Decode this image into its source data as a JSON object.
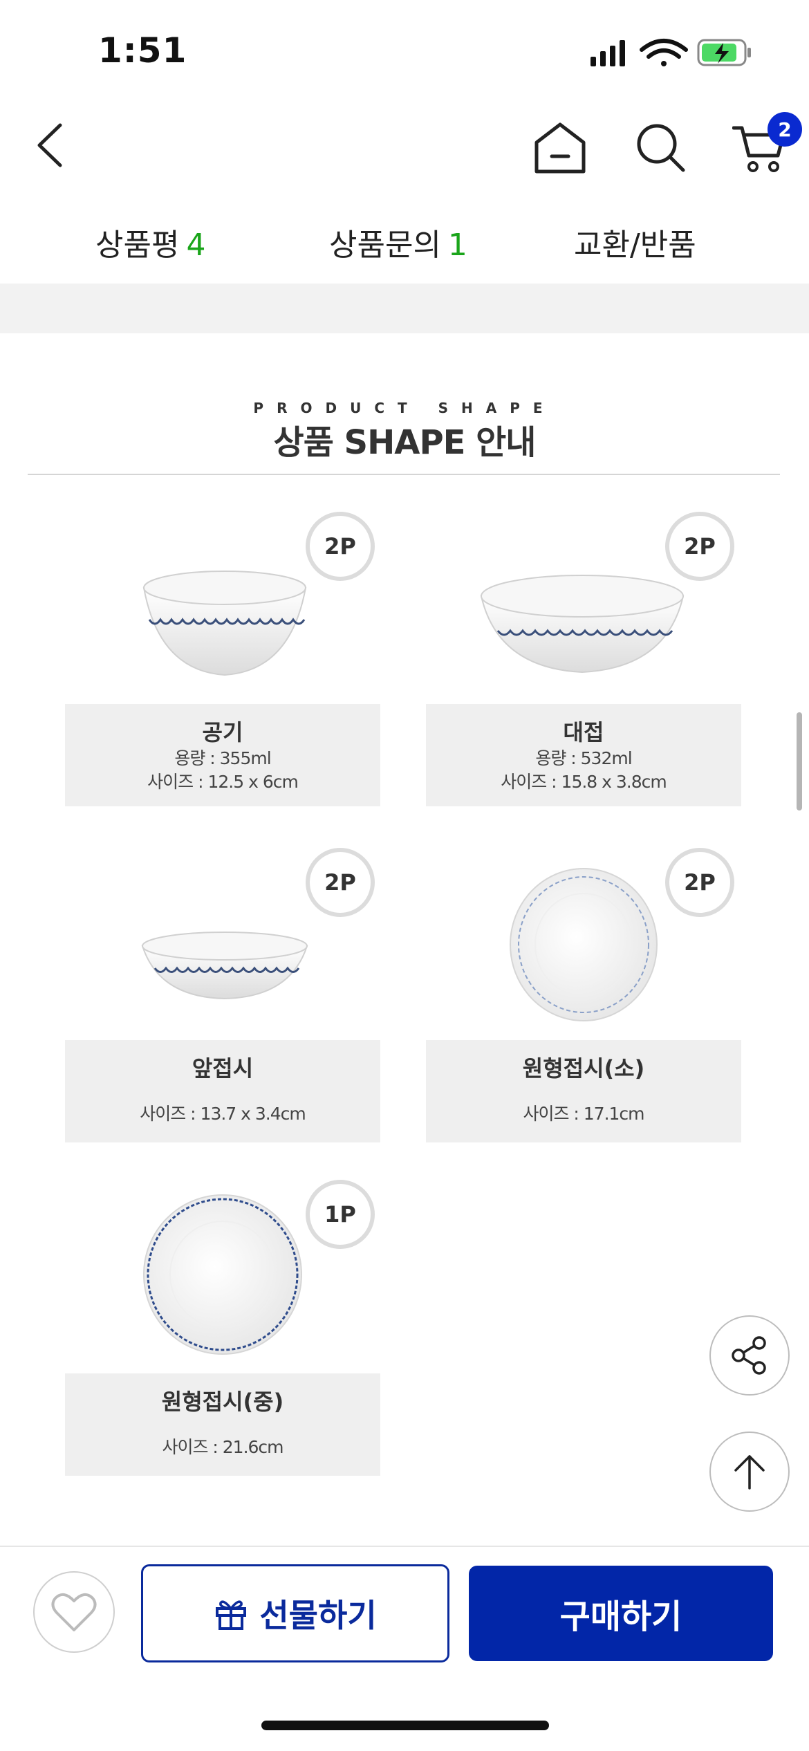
{
  "status_bar": {
    "time": "1:51"
  },
  "header": {
    "cart_count": "2"
  },
  "tabs": [
    {
      "label": "상품평",
      "count": "4"
    },
    {
      "label": "상품문의",
      "count": "1"
    },
    {
      "label": "교환/반품",
      "count": ""
    }
  ],
  "section": {
    "eyebrow": "PRODUCT SHAPE",
    "title": "상품 SHAPE 안내"
  },
  "products": [
    {
      "name": "공기",
      "qty": "2P",
      "lines": [
        "용량 : 355ml",
        "사이즈 : 12.5 x 6cm"
      ]
    },
    {
      "name": "대접",
      "qty": "2P",
      "lines": [
        "용량 : 532ml",
        "사이즈 : 15.8 x 3.8cm"
      ]
    },
    {
      "name": "앞접시",
      "qty": "2P",
      "lines": [
        "사이즈 : 13.7 x 3.4cm"
      ]
    },
    {
      "name": "원형접시(소)",
      "qty": "2P",
      "lines": [
        "사이즈 : 17.1cm"
      ]
    },
    {
      "name": "원형접시(중)",
      "qty": "1P",
      "lines": [
        "사이즈 : 21.6cm"
      ]
    }
  ],
  "bottom_bar": {
    "gift_label": "선물하기",
    "buy_label": "구매하기"
  },
  "colors": {
    "accent": "#0226a8",
    "count_green": "#1aa51a",
    "badge": "#0a2ad0"
  }
}
